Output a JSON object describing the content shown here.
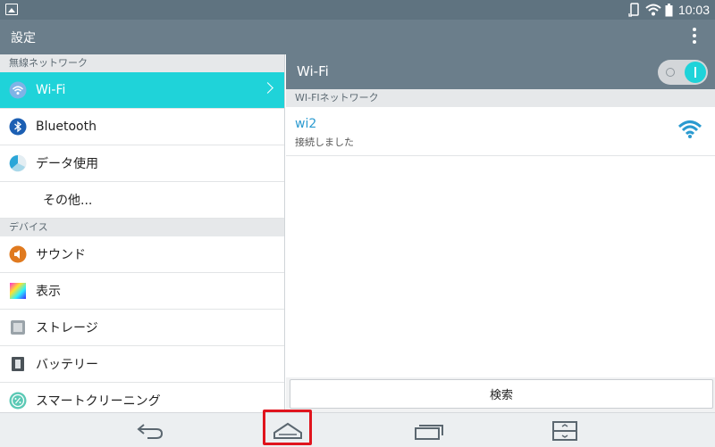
{
  "status": {
    "time": "10:03"
  },
  "actionbar": {
    "title": "設定"
  },
  "left": {
    "sections": [
      {
        "header": "無線ネットワーク"
      },
      {
        "header": "デバイス"
      }
    ],
    "items": [
      {
        "label": "Wi-Fi",
        "icon": "wifi-icon",
        "selected": true
      },
      {
        "label": "Bluetooth",
        "icon": "bluetooth-icon"
      },
      {
        "label": "データ使用",
        "icon": "data-usage-icon"
      },
      {
        "label": "その他...",
        "icon": ""
      },
      {
        "label": "サウンド",
        "icon": "sound-icon"
      },
      {
        "label": "表示",
        "icon": "display-icon"
      },
      {
        "label": "ストレージ",
        "icon": "storage-icon"
      },
      {
        "label": "バッテリー",
        "icon": "battery-icon"
      },
      {
        "label": "スマートクリーニング",
        "icon": "smart-cleaning-icon"
      }
    ]
  },
  "right": {
    "title": "Wi-Fi",
    "subheader": "WI-FIネットワーク",
    "network": {
      "ssid": "wi2",
      "status": "接続しました"
    },
    "search_label": "検索"
  },
  "colors": {
    "accent": "#1fd3d9",
    "bar": "#6b7e8b",
    "highlight": "#e0141d",
    "link": "#2a9ad0"
  }
}
